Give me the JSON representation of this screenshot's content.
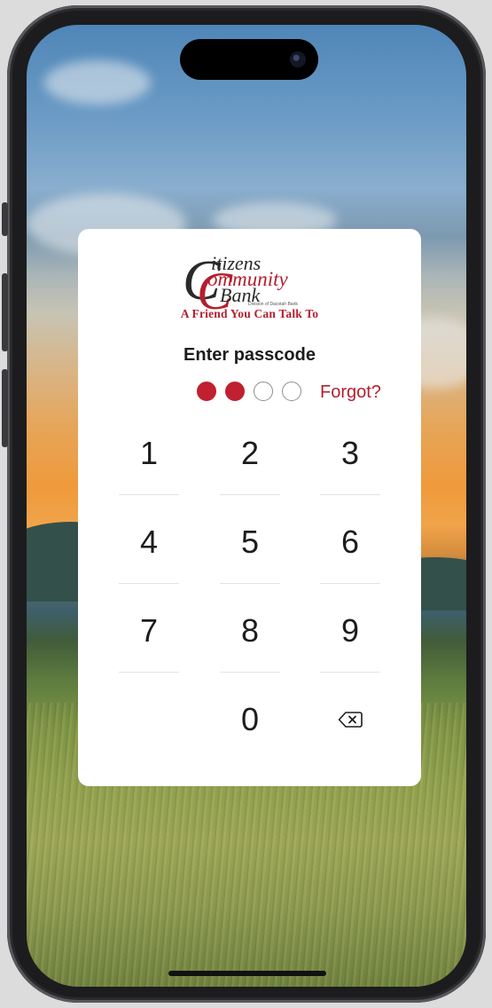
{
  "brand": {
    "line1": "itizens",
    "line2": "ommunity",
    "line3": "Bank",
    "big_c": "C",
    "division": "Division of Dacotah Bank",
    "tagline": "A Friend You Can Talk To",
    "color_red": "#b41f2e",
    "color_dark": "#2a2a2a"
  },
  "passcode": {
    "title": "Enter passcode",
    "digits_total": 4,
    "digits_entered": 2,
    "forgot_label": "Forgot?"
  },
  "keypad": {
    "keys": [
      "1",
      "2",
      "3",
      "4",
      "5",
      "6",
      "7",
      "8",
      "9",
      "0"
    ],
    "delete_icon": "backspace-icon"
  }
}
